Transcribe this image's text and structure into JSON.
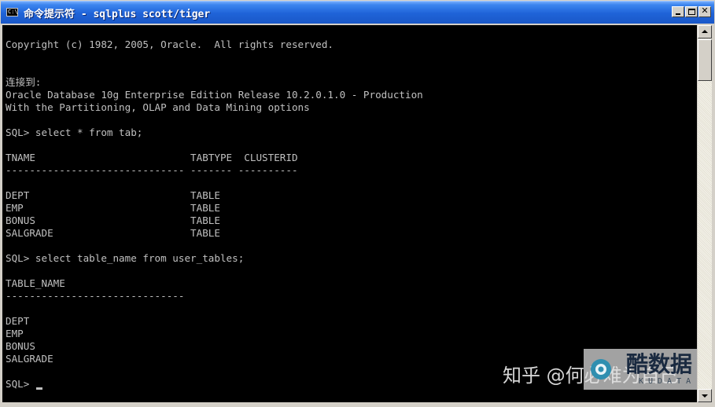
{
  "window": {
    "title": "命令提示符 - sqlplus scott/tiger",
    "icon": "console-window-icon",
    "icon_text": "C:\\",
    "buttons": {
      "minimize": "minimize-icon",
      "maximize": "maximize-icon",
      "close_glyph": "✕"
    }
  },
  "console": {
    "text_color": "#c0c0c0",
    "background": "#000000",
    "lines": [
      "",
      "Copyright (c) 1982, 2005, Oracle.  All rights reserved.",
      "",
      "",
      "连接到:",
      "Oracle Database 10g Enterprise Edition Release 10.2.0.1.0 - Production",
      "With the Partitioning, OLAP and Data Mining options",
      "",
      "SQL> select * from tab;",
      "",
      "TNAME                          TABTYPE  CLUSTERID",
      "------------------------------ ------- ----------",
      "",
      "DEPT                           TABLE",
      "EMP                            TABLE",
      "BONUS                          TABLE",
      "SALGRADE                       TABLE",
      "",
      "SQL> select table_name from user_tables;",
      "",
      "TABLE_NAME",
      "------------------------------",
      "",
      "DEPT",
      "EMP",
      "BONUS",
      "SALGRADE",
      "",
      "SQL> "
    ]
  },
  "watermark": {
    "text": "知乎 @何必难为自己",
    "brand": "酷数据",
    "brand_sub": "KUDATA"
  },
  "scrollbar": {
    "up_icon": "scroll-up-arrow-icon",
    "down_icon": "scroll-down-arrow-icon"
  }
}
